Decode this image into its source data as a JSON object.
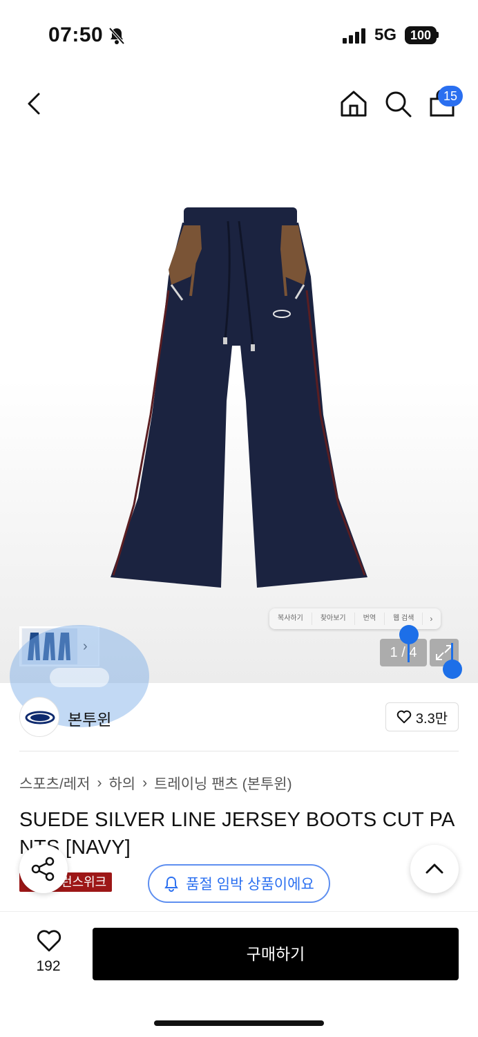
{
  "status_bar": {
    "time": "07:50",
    "network": "5G",
    "battery": "100"
  },
  "header": {
    "cart_count": "15"
  },
  "gallery": {
    "counter": "1 / 4",
    "selection_menu": [
      "복사하기",
      "찾아보기",
      "번역",
      "웹 검색"
    ]
  },
  "brand": {
    "name": "본투윈",
    "likes": "3.3만"
  },
  "breadcrumb": [
    "스포츠/레저",
    "하의",
    "트레이닝 팬츠 (본투윈)"
  ],
  "product": {
    "title": "SUEDE SILVER LINE JERSEY BOOTS CUT PANTS [NAVY]",
    "tag_visible": "런스위크"
  },
  "alert": {
    "label": "품절 임박 상품이에요"
  },
  "bottom": {
    "like_count": "192",
    "buy_label": "구매하기"
  },
  "colors": {
    "accent": "#2a6ff0",
    "tag": "#9d1717",
    "buy": "#000000",
    "pants": "#1b2340",
    "suede": "#7a5436"
  }
}
